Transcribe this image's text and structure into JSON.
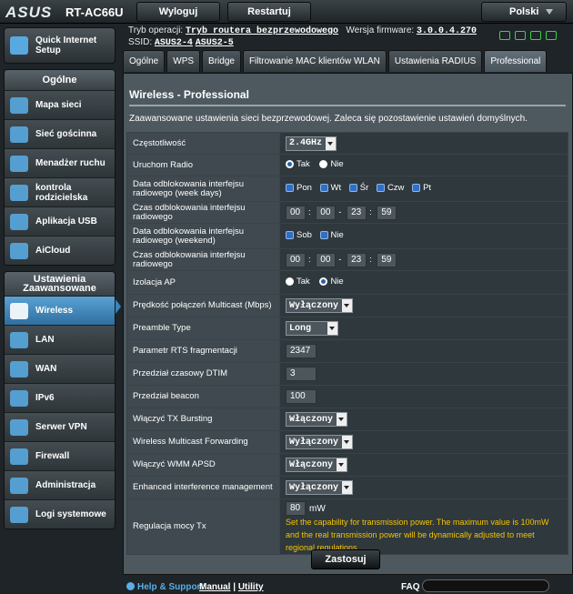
{
  "header": {
    "brand": "ASUS",
    "model": "RT-AC66U",
    "logout": "Wyloguj",
    "restart": "Restartuj",
    "language": "Polski"
  },
  "info": {
    "op_mode_label": "Tryb operacji:",
    "op_mode_value": "Tryb routera bezprzewodowego",
    "fw_label": "Wersja firmware:",
    "fw_value": "3.0.0.4.270",
    "ssid_label": "SSID:",
    "ssid1": "ASUS2-4",
    "ssid2": "ASUS2-5"
  },
  "sidebar": {
    "quick_setup": "Quick Internet Setup",
    "general_head": "Ogólne",
    "general": [
      "Mapa sieci",
      "Sieć gościnna",
      "Menadżer ruchu",
      "kontrola rodzicielska",
      "Aplikacja USB",
      "AiCloud"
    ],
    "advanced_head": "Ustawienia Zaawansowane",
    "advanced": [
      "Wireless",
      "LAN",
      "WAN",
      "IPv6",
      "Serwer VPN",
      "Firewall",
      "Administracja",
      "Logi systemowe"
    ]
  },
  "tabs": [
    "Ogólne",
    "WPS",
    "Bridge",
    "Filtrowanie MAC klientów WLAN",
    "Ustawienia RADIUS",
    "Professional"
  ],
  "panel": {
    "title": "Wireless - Professional",
    "description": "Zaawansowane ustawienia sieci bezprzewodowej. Zaleca się pozostawienie ustawień domyślnych."
  },
  "settings": {
    "frequency": {
      "label": "Częstotliwość",
      "value": "2.4GHz"
    },
    "radio": {
      "label": "Uruchom Radio",
      "yes": "Tak",
      "no": "Nie"
    },
    "weekdays": {
      "label": "Data odblokowania interfejsu radiowego (week days)",
      "days": [
        "Pon",
        "Wt",
        "Śr",
        "Czw",
        "Pt"
      ]
    },
    "weekday_time": {
      "label": "Czas odblokowania interfejsu radiowego",
      "h1": "00",
      "m1": "00",
      "h2": "23",
      "m2": "59"
    },
    "weekend": {
      "label": "Data odblokowania interfejsu radiowego (weekend)",
      "days": [
        "Sob",
        "Nie"
      ]
    },
    "weekend_time": {
      "label": "Czas odblokowania interfejsu radiowego",
      "h1": "00",
      "m1": "00",
      "h2": "23",
      "m2": "59"
    },
    "ap_isolation": {
      "label": "Izolacja AP",
      "yes": "Tak",
      "no": "Nie"
    },
    "multicast_rate": {
      "label": "Prędkość połączeń Multicast (Mbps)",
      "value": "Wyłączony"
    },
    "preamble": {
      "label": "Preamble Type",
      "value": "Long"
    },
    "rts": {
      "label": "Parametr RTS fragmentacji",
      "value": "2347"
    },
    "dtim": {
      "label": "Przedział czasowy DTIM",
      "value": "3"
    },
    "beacon": {
      "label": "Przedział beacon",
      "value": "100"
    },
    "tx_bursting": {
      "label": "Włączyć TX Bursting",
      "value": "Włączony"
    },
    "multicast_fwd": {
      "label": "Wireless Multicast Forwarding",
      "value": "Wyłączony"
    },
    "wmm_apsd": {
      "label": "Włączyć WMM APSD",
      "value": "Włączony"
    },
    "interference": {
      "label": "Enhanced interference management",
      "value": "Wyłączony"
    },
    "tx_power": {
      "label": "Regulacja mocy Tx",
      "value": "80",
      "unit": "mW",
      "note": "Set the capability for transmission power. The maximum value is 100mW and the real transmission power will be dynamically adjusted to meet regional regulations"
    }
  },
  "apply": "Zastosuj",
  "footer": {
    "help": "Help & Support",
    "manual": "Manual",
    "sep": "|",
    "utility": "Utility",
    "faq": "FAQ"
  }
}
